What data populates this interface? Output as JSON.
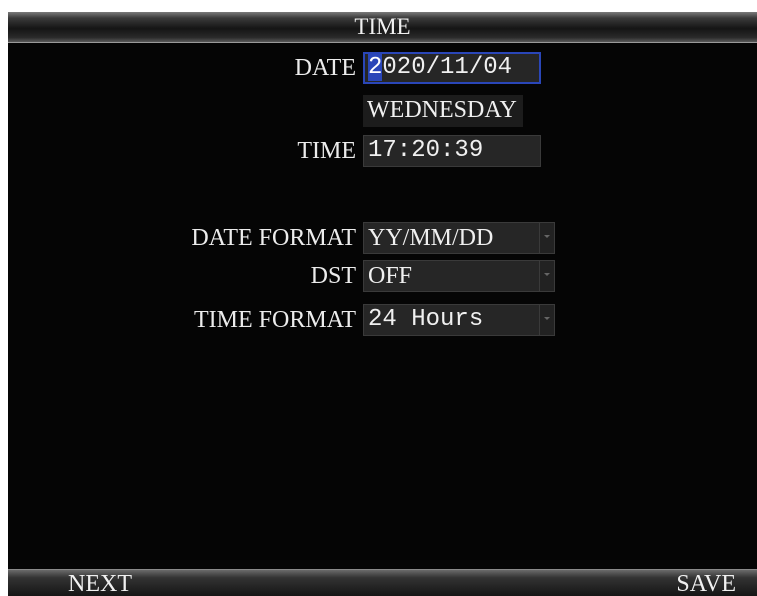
{
  "header": {
    "title": "TIME"
  },
  "fields": {
    "date": {
      "label": "DATE",
      "cursor_char": "2",
      "rest": "020/11/04"
    },
    "weekday": "WEDNESDAY",
    "time": {
      "label": "TIME",
      "value": "17:20:39"
    },
    "date_format": {
      "label": "DATE FORMAT",
      "value": "YY/MM/DD"
    },
    "dst": {
      "label": "DST",
      "value": "OFF"
    },
    "time_format": {
      "label": "TIME FORMAT",
      "value": "24 Hours"
    }
  },
  "footer": {
    "next_label": "NEXT",
    "save_label": "SAVE"
  },
  "colors": {
    "background": "#050505",
    "selection": "#2a46b8",
    "field": "#262626"
  }
}
